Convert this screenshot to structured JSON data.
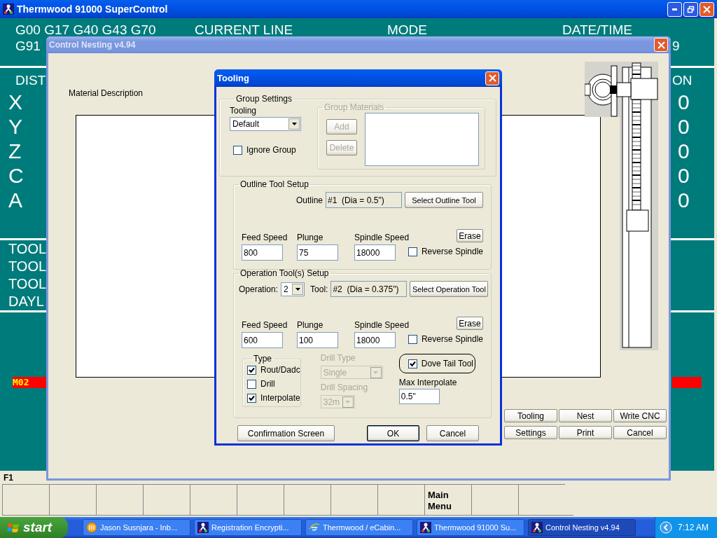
{
  "main_window": {
    "title": "Thermwood 91000 SuperControl",
    "gcode_lines": [
      "G00 G17 G40 G43 G70",
      "G91"
    ],
    "headers": [
      "CURRENT LINE",
      "MODE",
      "DATE/TIME"
    ],
    "date_fragment": "9",
    "dist_label": "DIST",
    "axes": [
      "X",
      "Y",
      "Z",
      "C",
      "A"
    ],
    "position_label_fragment": "ON",
    "position_values": [
      "0",
      "0",
      "0",
      "0",
      "0"
    ],
    "tool_lines": [
      "TOOL",
      "TOOL",
      "TOOL",
      "DAYL"
    ],
    "alarm": "M02",
    "function_key_label": "F1",
    "soft_keys": [
      {
        "kind": "blank"
      },
      {
        "kind": "blank"
      },
      {
        "kind": "blank"
      },
      {
        "kind": "blank"
      },
      {
        "kind": "blank"
      },
      {
        "kind": "blank"
      },
      {
        "kind": "blank"
      },
      {
        "kind": "blank"
      },
      {
        "kind": "blank"
      },
      {
        "kind": "labeled",
        "label": "Main Menu"
      },
      {
        "kind": "blank"
      },
      {
        "kind": "blank"
      }
    ]
  },
  "nesting_window": {
    "title": "Control Nesting v4.94",
    "active": false,
    "material_label": "Material Description",
    "buttons": [
      "Tooling",
      "Nest",
      "Write CNC",
      "Settings",
      "Print",
      "Cancel"
    ]
  },
  "tooling_dialog": {
    "title": "Tooling",
    "active": true,
    "group_settings": {
      "legend": "Group Settings",
      "tooling_label": "Tooling",
      "tooling_value": "Default",
      "ignore_group": {
        "label": "Ignore Group",
        "checked": false
      },
      "group_materials": {
        "legend": "Group Materials",
        "disabled": true,
        "buttons": [
          "Add",
          "Delete"
        ]
      }
    },
    "outline": {
      "legend": "Outline Tool Setup",
      "outline_label": "Outline",
      "outline_value": "#1  (Dia = 0.5\")",
      "select_button": "Select Outline Tool",
      "feed_label": "Feed Speed",
      "feed": "800",
      "plunge_label": "Plunge",
      "plunge": "75",
      "spindle_label": "Spindle Speed",
      "spindle": "18000",
      "erase": "Erase",
      "reverse": {
        "label": "Reverse Spindle",
        "checked": false
      }
    },
    "operation": {
      "legend": "Operation Tool(s) Setup",
      "operation_label": "Operation:",
      "operation_value": "2",
      "tool_label": "Tool:",
      "tool_value": "#2  (Dia = 0.375\")",
      "select_button": "Select Operation Tool",
      "feed_label": "Feed Speed",
      "feed": "600",
      "plunge_label": "Plunge",
      "plunge": "100",
      "spindle_label": "Spindle Speed",
      "spindle": "18000",
      "erase": "Erase",
      "reverse": {
        "label": "Reverse Spindle",
        "checked": false
      },
      "type": {
        "legend": "Type",
        "options": [
          {
            "label": "Rout/Dadc",
            "checked": true
          },
          {
            "label": "Drill",
            "checked": false
          },
          {
            "label": "Interpolate",
            "checked": true
          }
        ]
      },
      "drill_type": {
        "label": "Drill Type",
        "value": "Single",
        "disabled": true
      },
      "drill_spacing": {
        "label": "Drill Spacing",
        "value": "32m",
        "disabled": true
      },
      "dove_tail": {
        "label": "Dove Tail Tool",
        "checked": true
      },
      "max_interpolate": {
        "label": "Max Interpolate",
        "value": "0.5\""
      }
    },
    "buttons": [
      {
        "label": "Confirmation Screen",
        "default": false
      },
      {
        "label": "OK",
        "default": true
      },
      {
        "label": "Cancel",
        "default": false
      }
    ]
  },
  "taskbar": {
    "start": "start",
    "items": [
      {
        "label": "Jason Susnjara - Inb...",
        "active": false
      },
      {
        "label": "Registration Encrypti...",
        "active": false
      },
      {
        "label": "Thermwood / eCabin...",
        "active": false
      },
      {
        "label": "Thermwood 91000 Su...",
        "active": false
      },
      {
        "label": "Control Nesting v4.94",
        "active": true
      }
    ],
    "clock": "7:12 AM"
  }
}
